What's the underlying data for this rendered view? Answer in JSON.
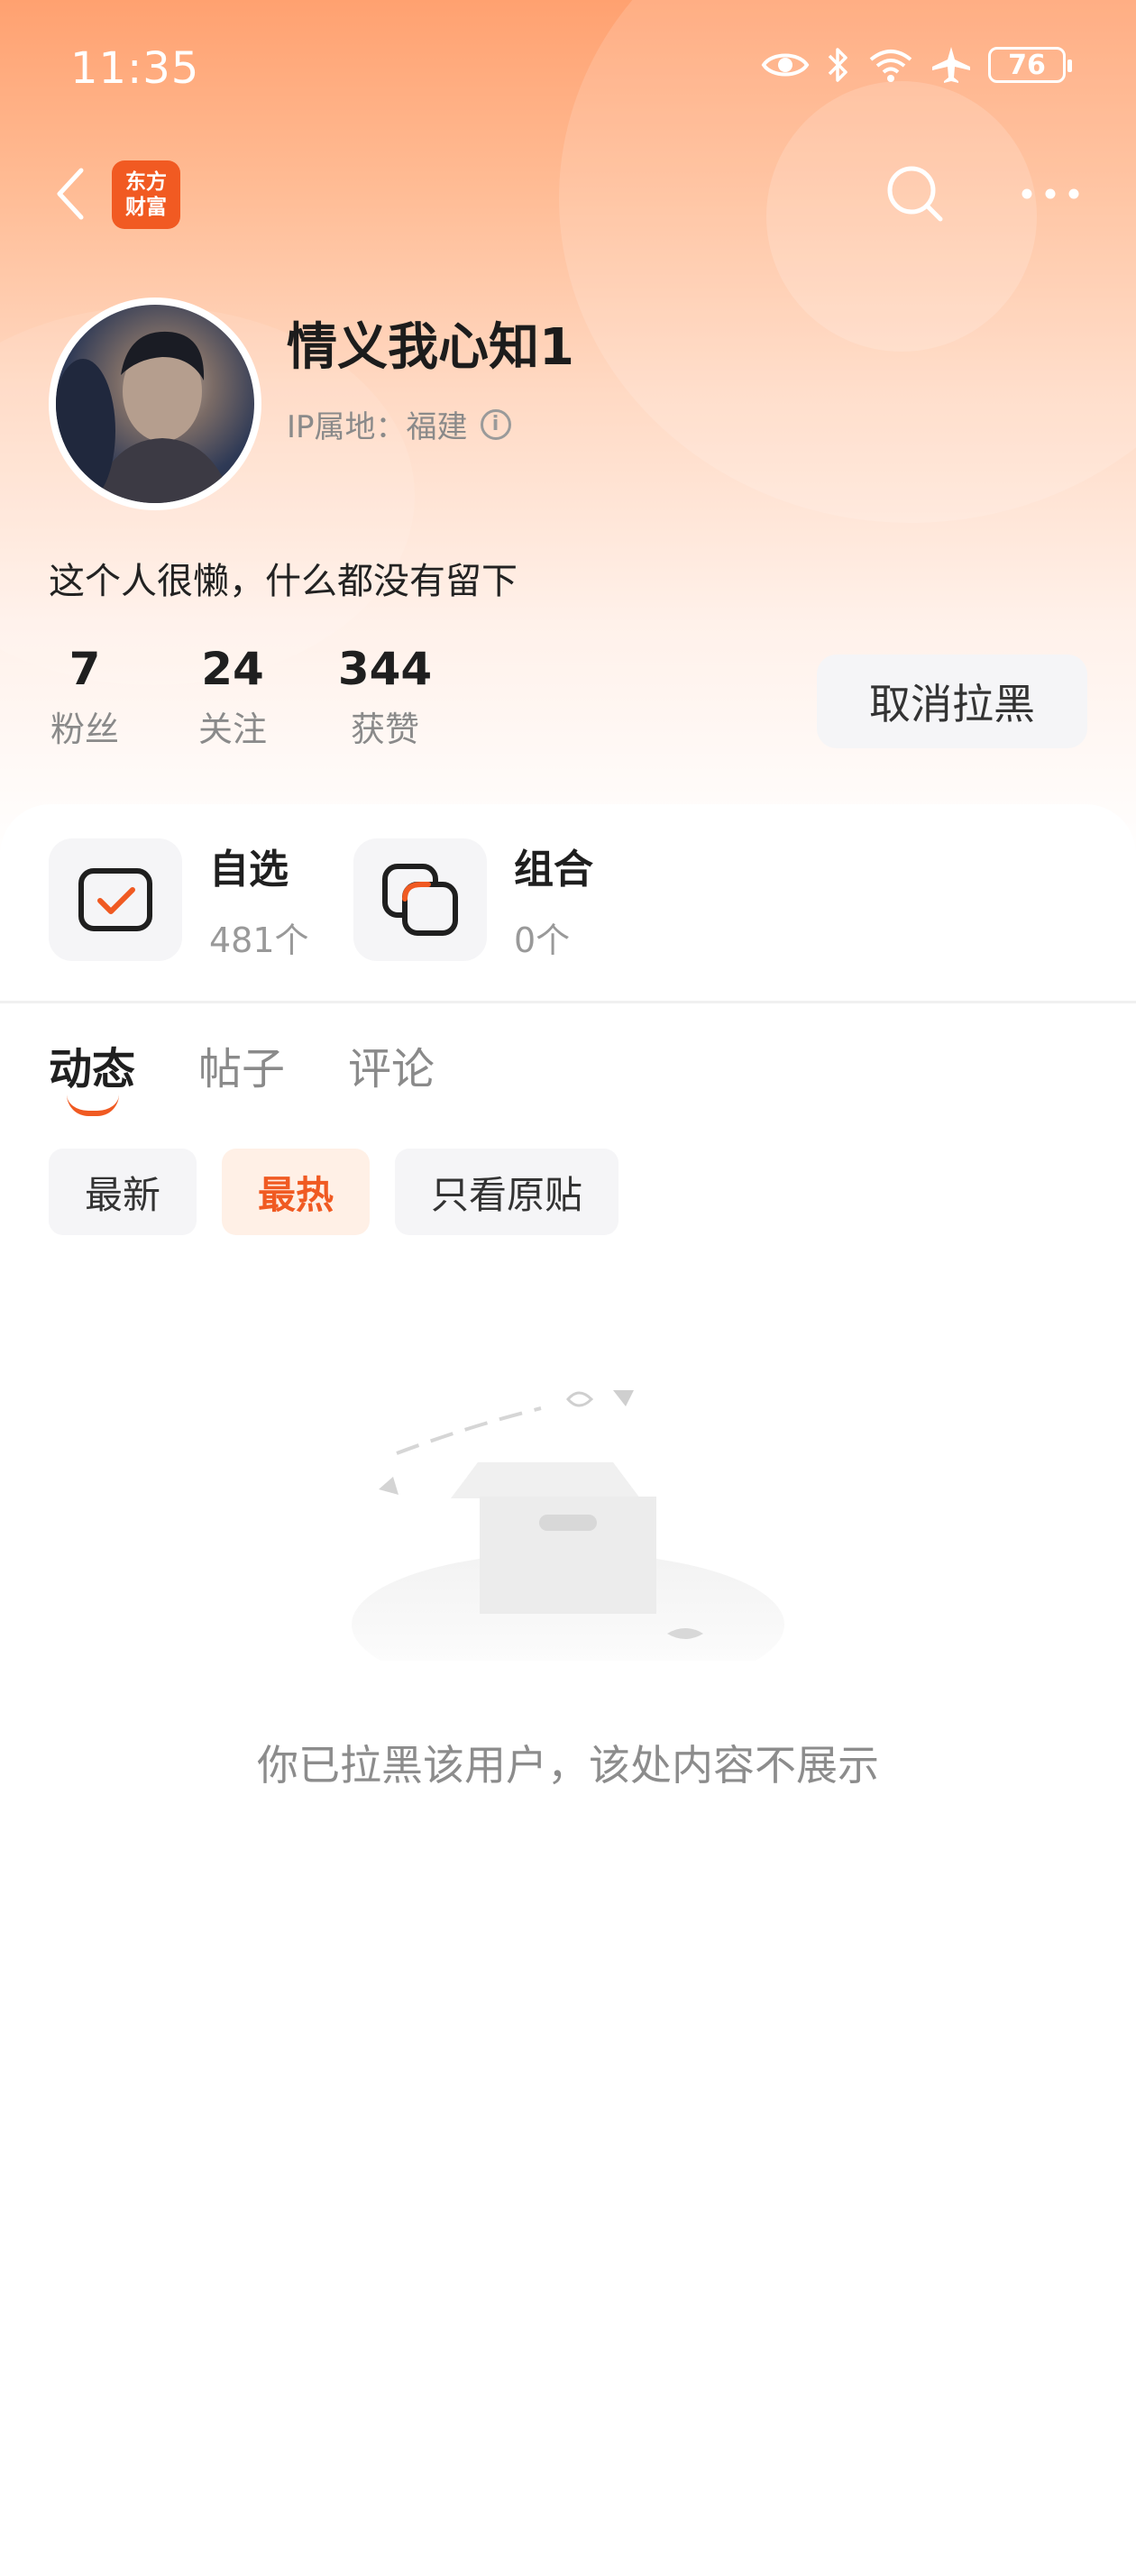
{
  "status_bar": {
    "time": "11:35",
    "battery": "76"
  },
  "navbar": {
    "logo_line1": "东方",
    "logo_line2": "财富",
    "logo_color": "#f15a22"
  },
  "profile": {
    "username": "情义我心知1",
    "ip_location": "IP属地：福建",
    "bio": "这个人很懒，什么都没有留下",
    "stats": [
      {
        "value": "7",
        "label": "粉丝"
      },
      {
        "value": "24",
        "label": "关注"
      },
      {
        "value": "344",
        "label": "获赞"
      }
    ],
    "unblock_label": "取消拉黑"
  },
  "shortcuts": [
    {
      "title": "自选",
      "count": "481个",
      "icon": "checkbox-icon"
    },
    {
      "title": "组合",
      "count": "0个",
      "icon": "stack-icon"
    }
  ],
  "tabs": [
    {
      "label": "动态",
      "active": true
    },
    {
      "label": "帖子",
      "active": false
    },
    {
      "label": "评论",
      "active": false
    }
  ],
  "filters": [
    {
      "label": "最新",
      "active": false
    },
    {
      "label": "最热",
      "active": true
    },
    {
      "label": "只看原贴",
      "active": false
    }
  ],
  "empty_state": {
    "message": "你已拉黑该用户，该处内容不展示"
  },
  "colors": {
    "accent": "#f05a22",
    "header_gradient_top": "#ffa170"
  }
}
